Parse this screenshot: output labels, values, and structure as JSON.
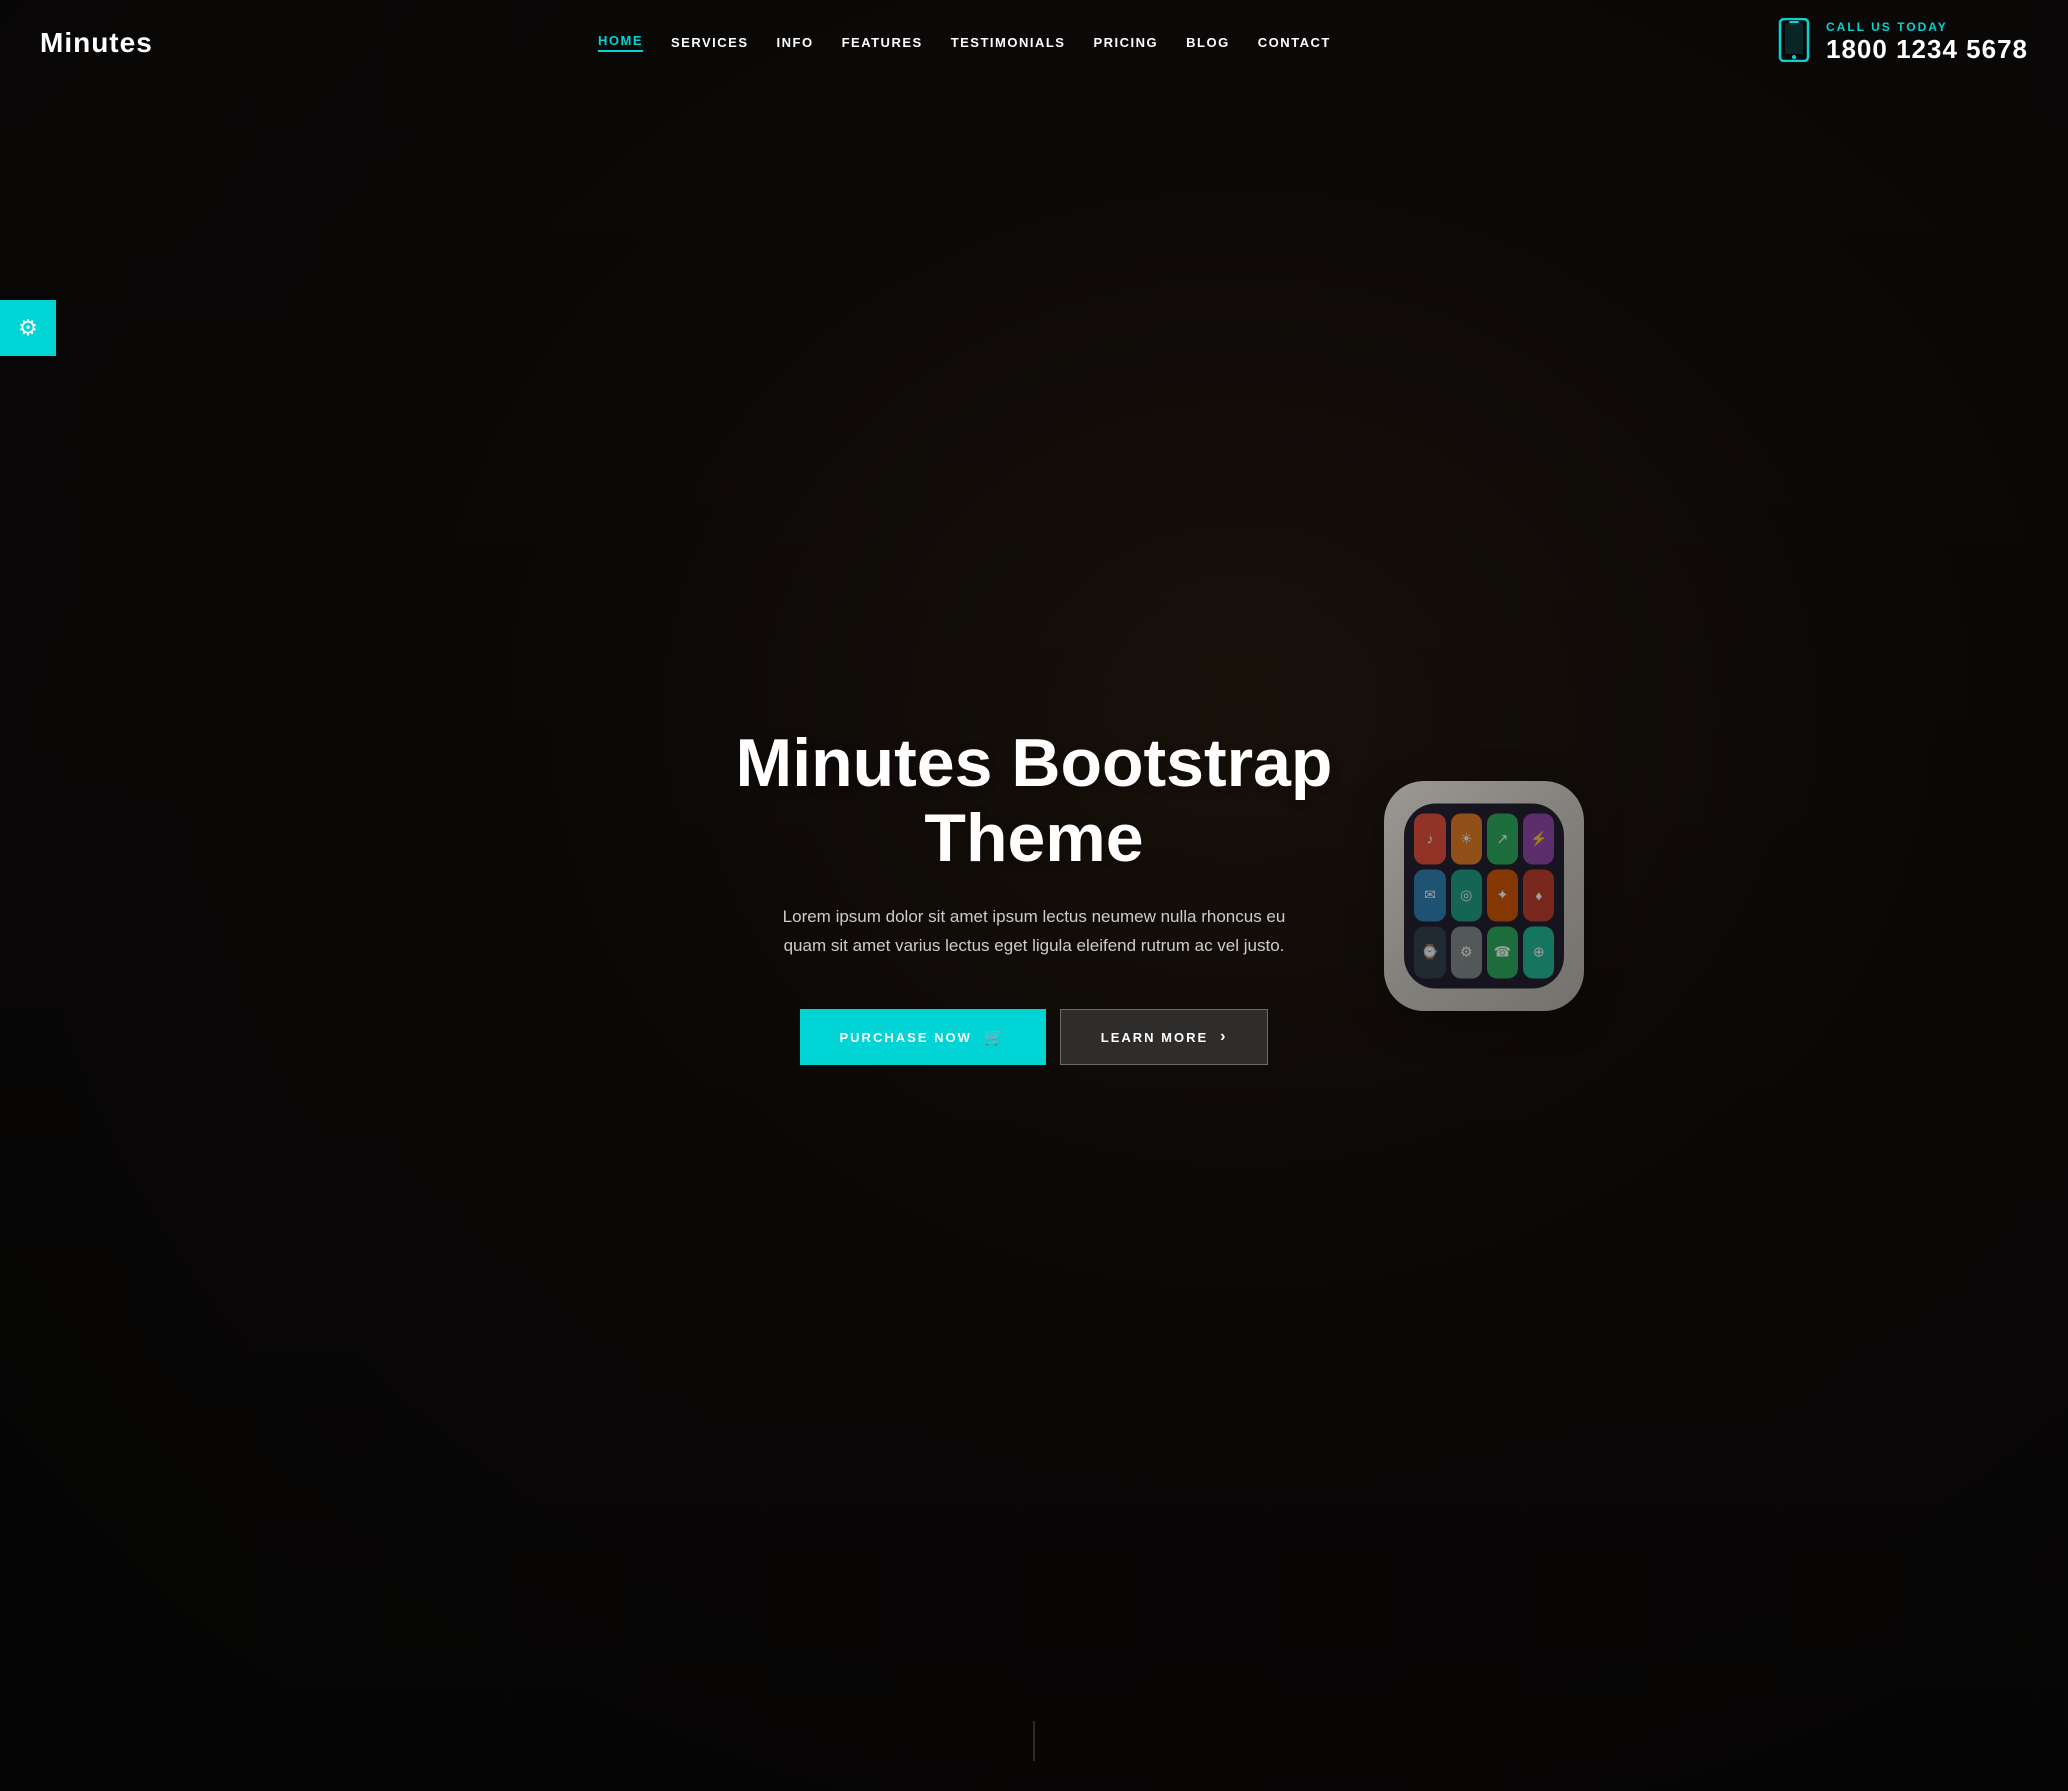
{
  "brand": {
    "logo": "Minutes"
  },
  "nav": {
    "items": [
      {
        "label": "HOME",
        "active": true
      },
      {
        "label": "SERVICES",
        "active": false
      },
      {
        "label": "INFO",
        "active": false
      },
      {
        "label": "FEATURES",
        "active": false
      },
      {
        "label": "TESTIMONIALS",
        "active": false
      },
      {
        "label": "PRICING",
        "active": false
      },
      {
        "label": "BLOG",
        "active": false
      },
      {
        "label": "CONTACT",
        "active": false
      }
    ]
  },
  "header": {
    "call_label": "CALL US TODAY",
    "phone": "1800 1234 5678"
  },
  "hero": {
    "title": "Minutes Bootstrap Theme",
    "description": "Lorem ipsum dolor sit amet ipsum lectus neumew nulla rhoncus eu quam sit amet varius lectus eget ligula eleifend rutrum ac vel justo.",
    "btn_primary": "PURCHASE NOW",
    "btn_secondary": "LEARN MORE"
  },
  "settings": {
    "icon": "⚙"
  },
  "colors": {
    "accent": "#00d4d4",
    "dark": "#1a1a1a"
  },
  "watch": {
    "apps": [
      {
        "color": "#e74c3c",
        "icon": "♪"
      },
      {
        "color": "#e67e22",
        "icon": "☀"
      },
      {
        "color": "#27ae60",
        "icon": "↗"
      },
      {
        "color": "#8e44ad",
        "icon": "⚡"
      },
      {
        "color": "#2980b9",
        "icon": "✉"
      },
      {
        "color": "#16a085",
        "icon": "◎"
      },
      {
        "color": "#d35400",
        "icon": "✦"
      },
      {
        "color": "#c0392b",
        "icon": "♦"
      },
      {
        "color": "#2c3e50",
        "icon": "⌚"
      },
      {
        "color": "#7f8c8d",
        "icon": "⚙"
      },
      {
        "color": "#27ae60",
        "icon": "☎"
      },
      {
        "color": "#1abc9c",
        "icon": "⊕"
      }
    ]
  }
}
